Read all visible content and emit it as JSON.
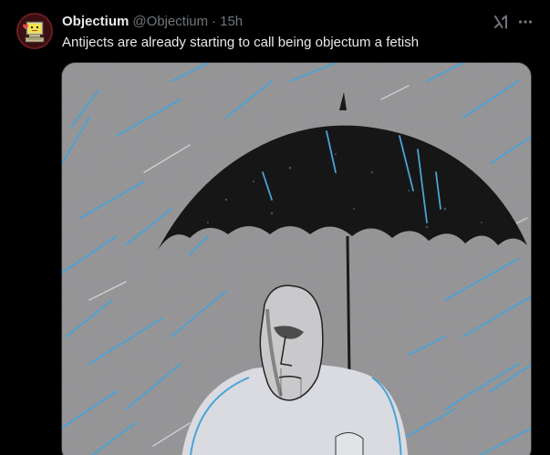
{
  "tweet": {
    "display_name": "Objectium",
    "handle": "@Objectium",
    "separator": "·",
    "time": "15h",
    "text": "Antijects are already starting to call being objectum a fetish"
  },
  "icons": {
    "grok": "grok-icon",
    "more": "more-icon"
  },
  "colors": {
    "background": "#000000",
    "text_primary": "#e7e9ea",
    "text_secondary": "#71767b",
    "rain": "#4aa3d8",
    "sky": "#8a8a8c"
  }
}
